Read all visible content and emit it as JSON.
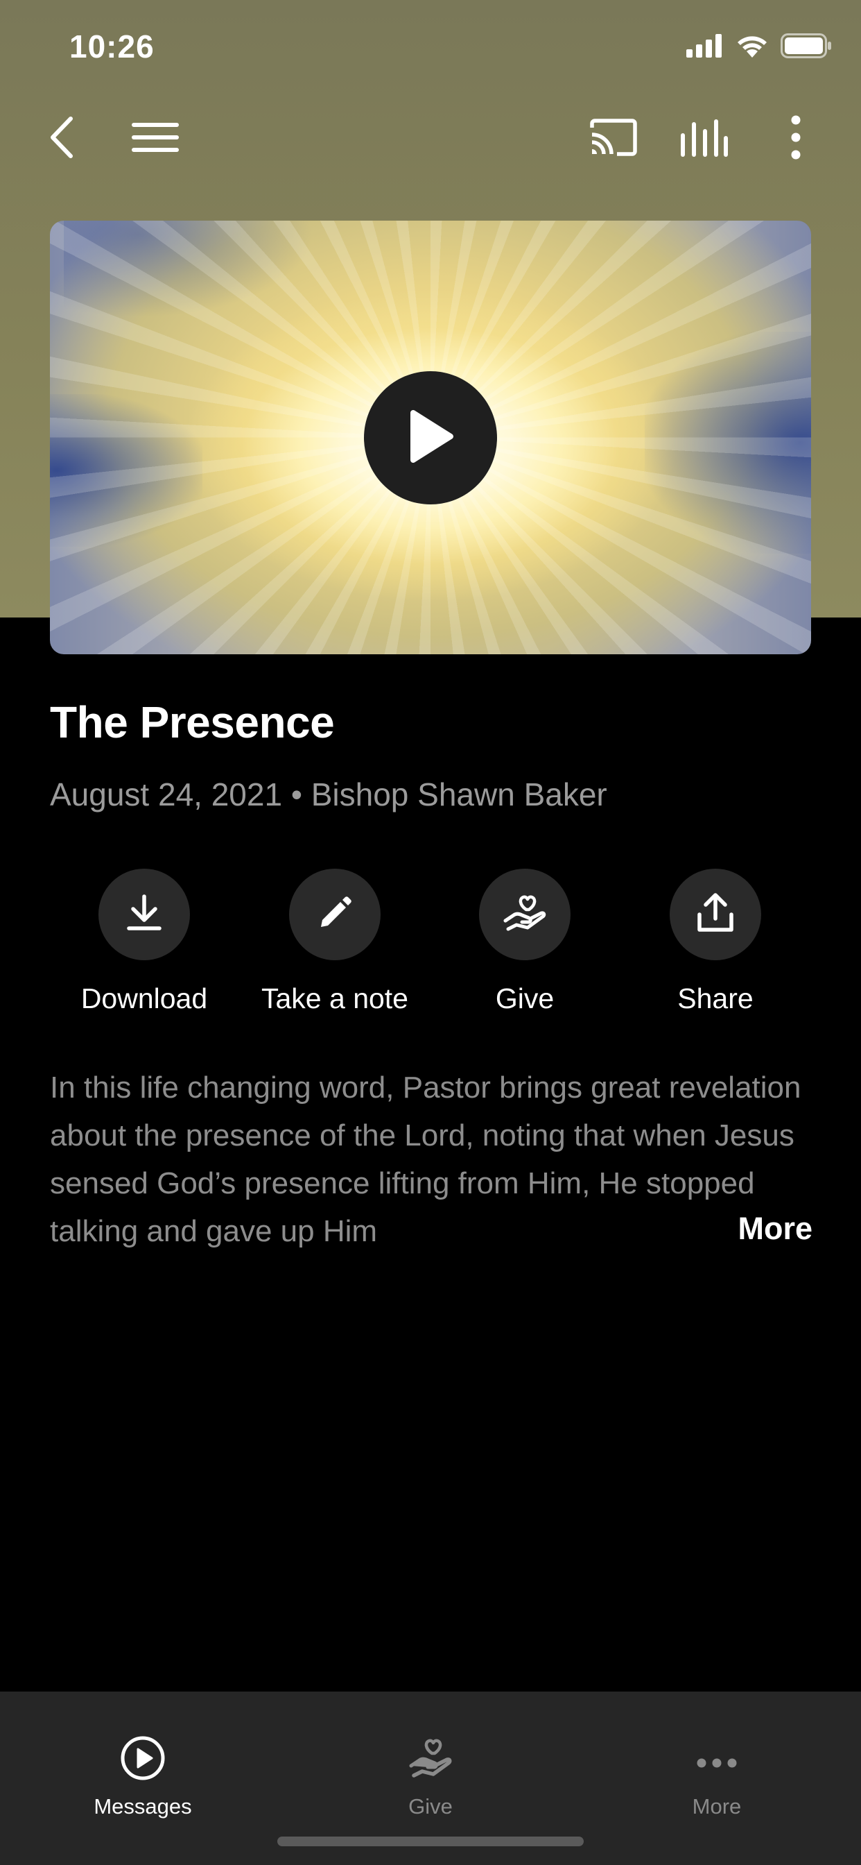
{
  "status_bar": {
    "time": "10:26",
    "icons": [
      "cellular-signal-icon",
      "wifi-icon",
      "battery-icon"
    ]
  },
  "nav": {
    "left_icons": [
      "back-chevron-icon",
      "menu-icon"
    ],
    "right_icons": [
      "cast-icon",
      "audio-bars-icon",
      "more-vertical-icon"
    ]
  },
  "video": {
    "play_icon": "play-icon"
  },
  "sermon": {
    "title": "The Presence",
    "meta": "August 24, 2021 • Bishop Shawn Baker"
  },
  "actions": [
    {
      "label": "Download",
      "icon": "download-icon"
    },
    {
      "label": "Take a note",
      "icon": "pencil-icon"
    },
    {
      "label": "Give",
      "icon": "give-hand-heart-icon"
    },
    {
      "label": "Share",
      "icon": "share-icon"
    }
  ],
  "description": {
    "text": "In this life changing word, Pastor brings great revelation about the presence of the Lord, noting that when Jesus sensed God’s presence lifting from Him, He stopped talking and gave up Him",
    "more_label": "More"
  },
  "tab_bar": {
    "tabs": [
      {
        "label": "Messages",
        "icon": "play-circle-icon",
        "active": true
      },
      {
        "label": "Give",
        "icon": "give-hand-heart-icon",
        "active": false
      },
      {
        "label": "More",
        "icon": "more-horizontal-icon",
        "active": false
      }
    ]
  },
  "colors": {
    "header": "#858259",
    "background": "#000000",
    "tab_bar": "#262626",
    "action_circle": "#2a2a2a",
    "muted_text": "#9b9b9b",
    "inactive_tab": "#8a8a8a"
  }
}
